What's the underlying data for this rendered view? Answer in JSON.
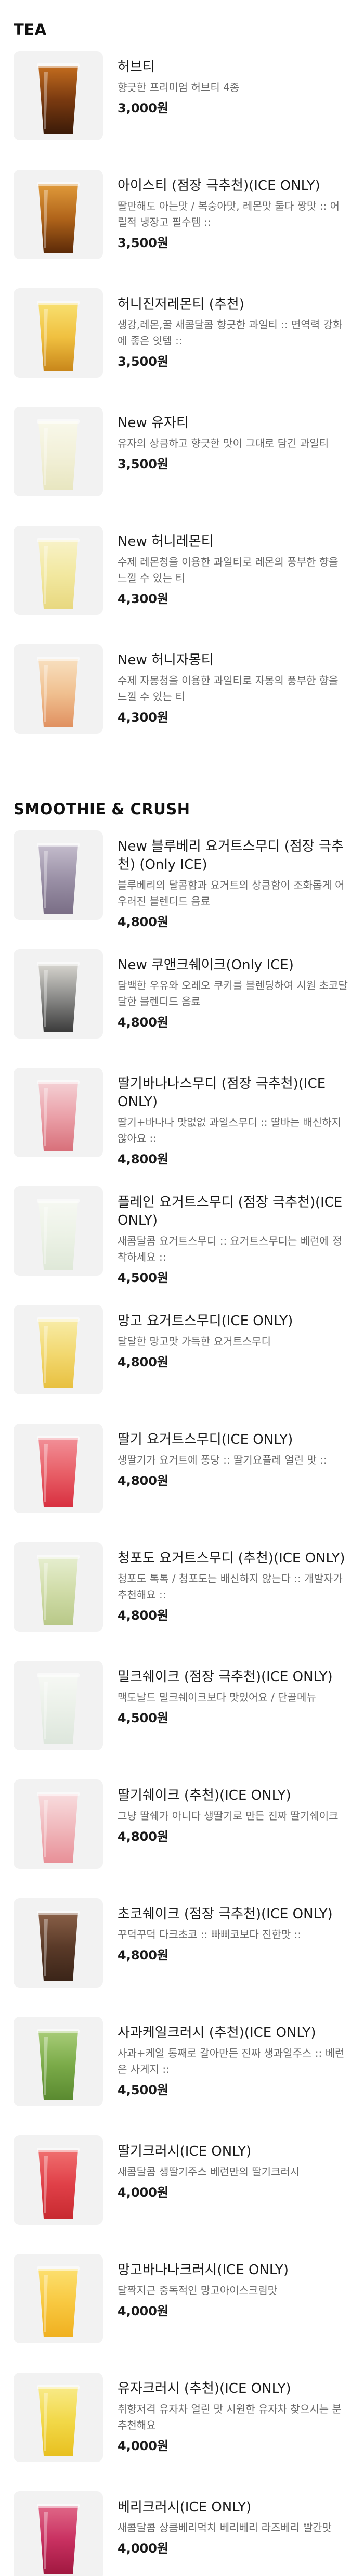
{
  "sections": [
    {
      "title": "TEA",
      "items": [
        {
          "name": "허브티",
          "desc": "향긋한 프리미엄 허브티 4종",
          "price": "3,000원",
          "icon": "herb-tea-icon",
          "colors": [
            "#3a1a08",
            "#7a3a10",
            "#c46d1e"
          ]
        },
        {
          "name": "아이스티 (점장 극추천)(ICE ONLY)",
          "desc": "딸만해도 아는맛 / 복숭아맛, 레몬맛 둘다 짱맛 :: 어릴적 냉장고 필수템 ::",
          "price": "3,500원",
          "icon": "iced-tea-icon",
          "colors": [
            "#5c2a08",
            "#b0641a",
            "#e09a3a"
          ]
        },
        {
          "name": "허니진저레몬티 (추천)",
          "desc": "생강,레몬,꿀 새콤달콤 향긋한 과일티 :: 면역력 강화에 좋은 잇템 ::",
          "price": "3,500원",
          "icon": "honey-ginger-lemon-tea-icon",
          "colors": [
            "#c8861a",
            "#f0c040",
            "#f8e070"
          ]
        },
        {
          "name": "New 유자티",
          "desc": "유자의 상큼하고 향긋한 맛이 그대로 담긴 과일티",
          "price": "3,500원",
          "icon": "yuja-tea-icon",
          "colors": [
            "#e8e6c0",
            "#f2f0d8",
            "#f8f8ea"
          ]
        },
        {
          "name": "New 허니레몬티",
          "desc": "수제 레몬청을 이용한 과일티로 레몬의 풍부한 향을 느낄 수 있는 티",
          "price": "4,300원",
          "icon": "honey-lemon-tea-icon",
          "colors": [
            "#e8d880",
            "#f2e8a0",
            "#f8f2c8"
          ]
        },
        {
          "name": "New 허니자몽티",
          "desc": "수제 자몽청을 이용한 과일티로 자몽의 풍부한 향을 느낄 수 있는 티",
          "price": "4,300원",
          "icon": "honey-grapefruit-tea-icon",
          "colors": [
            "#e09060",
            "#f0c090",
            "#f8e0c0"
          ]
        }
      ]
    },
    {
      "title": "SMOOTHIE & CRUSH",
      "items": [
        {
          "name": "New 블루베리 요거트스무디 (점장 극추천) (Only ICE)",
          "desc": "블루베리의 달콤함과 요거트의 상큼함이 조화롭게 어우러진 블렌디드 음료",
          "price": "4,800원",
          "icon": "blueberry-yogurt-smoothie-icon",
          "colors": [
            "#7a6e86",
            "#9a90a6",
            "#c4bccc"
          ]
        },
        {
          "name": "New 쿠앤크쉐이크(Only ICE)",
          "desc": "담백한 우유와 오레오 쿠키를 블렌딩하여 시원 초코달달한 블렌디드 음료",
          "price": "4,800원",
          "icon": "cookie-cream-shake-icon",
          "colors": [
            "#3a3a3a",
            "#8a8a88",
            "#d8d6d0"
          ]
        },
        {
          "name": "딸기바나나스무디 (점장 극추천)(ICE ONLY)",
          "desc": "딸기+바나나 맛없없 과일스무디 :: 딸바는 배신하지않아요 ::",
          "price": "4,800원",
          "icon": "strawberry-banana-smoothie-icon",
          "colors": [
            "#d8707a",
            "#eaa0a8",
            "#f4d0d4"
          ]
        },
        {
          "name": "플레인 요거트스무디 (점장 극추천)(ICE ONLY)",
          "desc": "새콤달콤 요거트스무디 :: 요거트스무디는 베런에 정착하세요 ::",
          "price": "4,500원",
          "icon": "plain-yogurt-smoothie-icon",
          "colors": [
            "#dfe8d8",
            "#ecf2e6",
            "#f6f8f2"
          ]
        },
        {
          "name": "망고 요거트스무디(ICE ONLY)",
          "desc": "달달한 망고맛 가득한 요거트스무디",
          "price": "4,800원",
          "icon": "mango-yogurt-smoothie-icon",
          "colors": [
            "#e8c040",
            "#f2d870",
            "#f8eca8"
          ]
        },
        {
          "name": "딸기 요거트스무디(ICE ONLY)",
          "desc": "생딸기가 요거트에 퐁당 :: 딸기요플레 얼린 맛 ::",
          "price": "4,800원",
          "icon": "strawberry-yogurt-smoothie-icon",
          "colors": [
            "#d83040",
            "#e86068",
            "#f29098"
          ]
        },
        {
          "name": "청포도 요거트스무디 (추천)(ICE ONLY)",
          "desc": "청포도 톡톡 / 청포도는 배신하지 않는다 :: 개발자가 추천해요 ::",
          "price": "4,800원",
          "icon": "green-grape-yogurt-smoothie-icon",
          "colors": [
            "#b8c888",
            "#d0dca8",
            "#e6eed0"
          ]
        },
        {
          "name": "밀크쉐이크 (점장 극추천)(ICE ONLY)",
          "desc": "맥도날드 밀크쉐이크보다 맛있어요 / 단골메뉴",
          "price": "4,500원",
          "icon": "milkshake-icon",
          "colors": [
            "#dde6dc",
            "#eaf0e8",
            "#f6f8f4"
          ]
        },
        {
          "name": "딸기쉐이크 (추천)(ICE ONLY)",
          "desc": "그냥 딸쉐가 아니다 생딸기로 만든 진짜 딸기쉐이크",
          "price": "4,800원",
          "icon": "strawberry-shake-icon",
          "colors": [
            "#e89098",
            "#f0b8bc",
            "#f8dcde"
          ]
        },
        {
          "name": "초코쉐이크 (점장 극추천)(ICE ONLY)",
          "desc": "꾸덕꾸덕 다크초코 :: 빠삐코보다 진한맛 ::",
          "price": "4,800원",
          "icon": "chocolate-shake-icon",
          "colors": [
            "#3a2418",
            "#5a3a28",
            "#8a6048"
          ]
        },
        {
          "name": "사과케일크러시 (추천)(ICE ONLY)",
          "desc": "사과+케일 통째로 갈아만든 진짜 생과일주스 :: 베런은 사게지 ::",
          "price": "4,500원",
          "icon": "apple-kale-crush-icon",
          "colors": [
            "#5a8a30",
            "#7aaa48",
            "#a8cc78"
          ]
        },
        {
          "name": "딸기크러시(ICE ONLY)",
          "desc": "새콤달콤 생딸기주스 베런만의 딸기크러시",
          "price": "4,000원",
          "icon": "strawberry-crush-icon",
          "colors": [
            "#c82a30",
            "#e04048",
            "#f07070"
          ]
        },
        {
          "name": "망고바나나크러시(ICE ONLY)",
          "desc": "달짝지근 중독적인 망고아이스크림맛",
          "price": "4,000원",
          "icon": "mango-banana-crush-icon",
          "colors": [
            "#f0b020",
            "#f8c840",
            "#fce070"
          ]
        },
        {
          "name": "유자크러시 (추천)(ICE ONLY)",
          "desc": "취향저격 유자차 얼린 맛 시원한 유자차 찾으시는 분 추천해요",
          "price": "4,000원",
          "icon": "yuja-crush-icon",
          "colors": [
            "#e8c020",
            "#f2d848",
            "#f8ea88"
          ]
        },
        {
          "name": "베리크러시(ICE ONLY)",
          "desc": "새콤달콤 상큼베리먹치 베리베리 라즈베리 빨간맛",
          "price": "4,000원",
          "icon": "berry-crush-icon",
          "colors": [
            "#a01840",
            "#c83060",
            "#e06888"
          ]
        }
      ]
    }
  ]
}
